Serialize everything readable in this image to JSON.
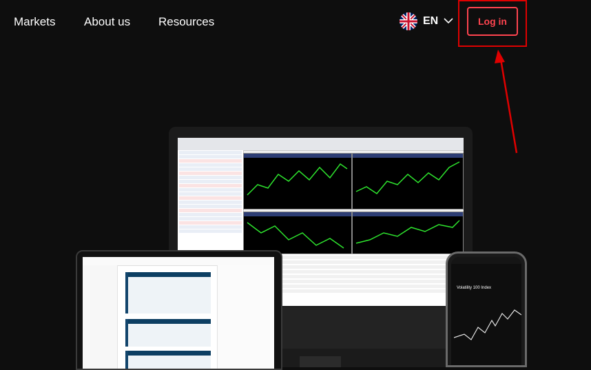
{
  "nav": {
    "markets": "Markets",
    "about": "About us",
    "resources": "Resources"
  },
  "language": {
    "code": "EN"
  },
  "auth": {
    "login": "Log in"
  },
  "colors": {
    "accent": "#ff444f",
    "highlight": "#e00000",
    "background": "#0e0e0e"
  },
  "phone": {
    "title": "Volatility 100 Index"
  }
}
